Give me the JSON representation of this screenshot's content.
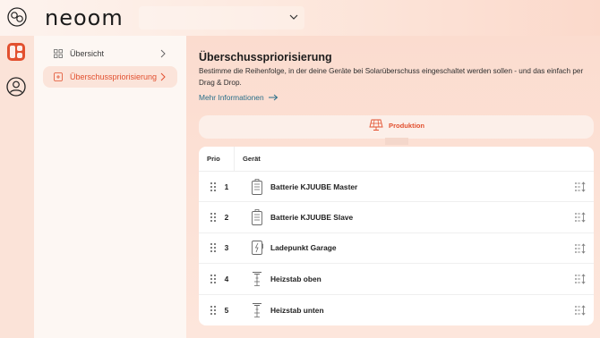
{
  "app": {
    "logo_text": "neoom"
  },
  "sidebar": {
    "items": [
      {
        "label": "Übersicht"
      },
      {
        "label": "Überschusspriorisierung"
      }
    ]
  },
  "page": {
    "title": "Überschusspriorisierung",
    "description": "Bestimme die Reihenfolge, in der deine Geräte bei Solarüberschuss eingeschaltet werden sollen - und das einfach per Drag & Drop.",
    "more_link": "Mehr Informationen"
  },
  "tabs": {
    "production": "Produktion"
  },
  "table": {
    "headers": {
      "prio": "Prio",
      "device": "Gerät"
    },
    "rows": [
      {
        "prio": "1",
        "name": "Batterie KJUUBE Master",
        "icon": "battery-icon"
      },
      {
        "prio": "2",
        "name": "Batterie KJUUBE Slave",
        "icon": "battery-icon"
      },
      {
        "prio": "3",
        "name": "Ladepunkt Garage",
        "icon": "charging-point-icon"
      },
      {
        "prio": "4",
        "name": "Heizstab oben",
        "icon": "heating-rod-icon"
      },
      {
        "prio": "5",
        "name": "Heizstab unten",
        "icon": "heating-rod-icon"
      }
    ]
  },
  "colors": {
    "accent": "#e2502f",
    "link": "#2a6f8a",
    "background": "#fde8df"
  }
}
